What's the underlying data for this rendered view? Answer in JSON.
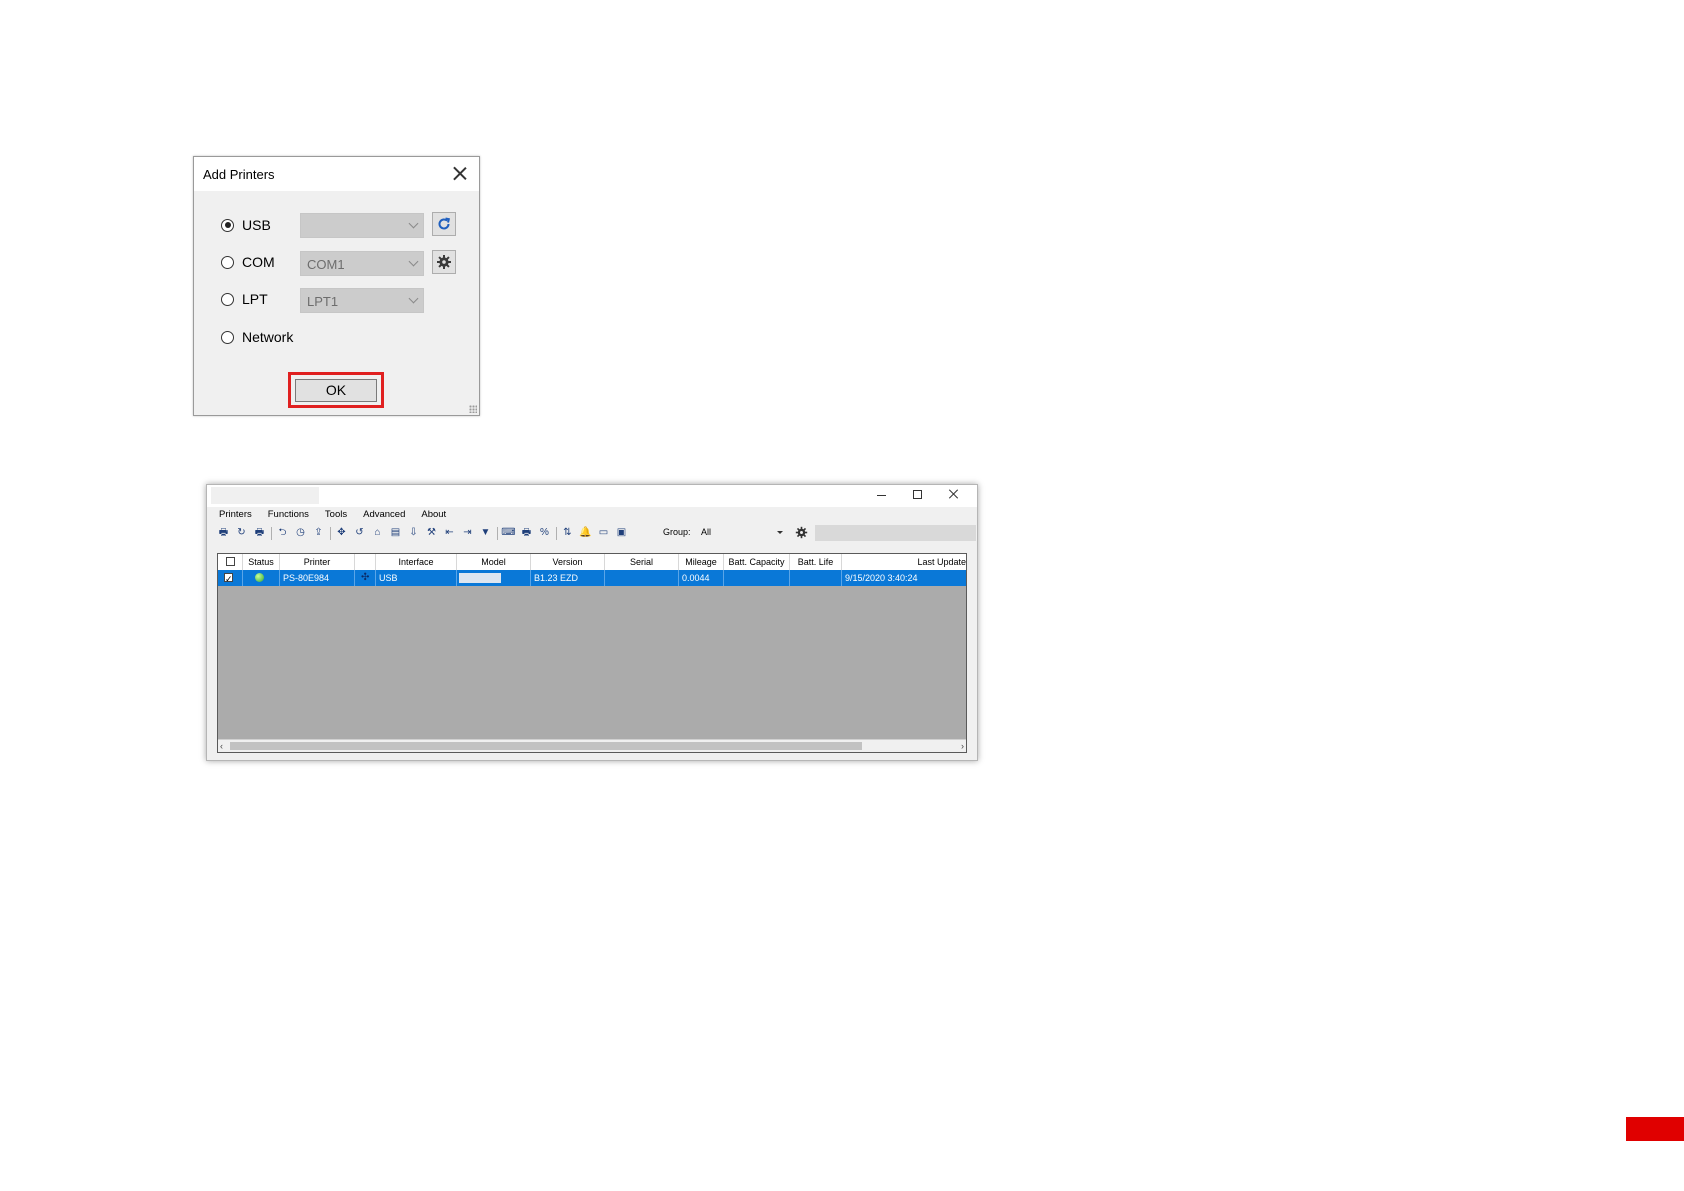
{
  "dialog": {
    "title": "Add Printers",
    "options": [
      {
        "label": "USB",
        "selected": true,
        "select_value": ""
      },
      {
        "label": "COM",
        "selected": false,
        "select_value": "COM1"
      },
      {
        "label": "LPT",
        "selected": false,
        "select_value": "LPT1"
      },
      {
        "label": "Network",
        "selected": false
      }
    ],
    "ok_label": "OK",
    "highlight_color": "#e02020"
  },
  "console": {
    "menu": [
      "Printers",
      "Functions",
      "Tools",
      "Advanced",
      "About"
    ],
    "group_label": "Group:",
    "group_value": "All",
    "columns": [
      "Status",
      "Printer",
      "Interface",
      "Model",
      "Version",
      "Serial",
      "Mileage",
      "Batt. Capacity",
      "Batt. Life",
      "Last Update"
    ],
    "rows": [
      {
        "checked": true,
        "status": "online",
        "printer": "PS-80E984",
        "interface": "USB",
        "model": "",
        "version": "B1.23 EZD",
        "serial": "",
        "mileage": "0.0044",
        "batt_capacity": "",
        "batt_life": "",
        "last_update": "9/15/2020 3:40:24"
      }
    ],
    "selection_color": "#0a78d7"
  },
  "page_marker_color": "#e00000"
}
